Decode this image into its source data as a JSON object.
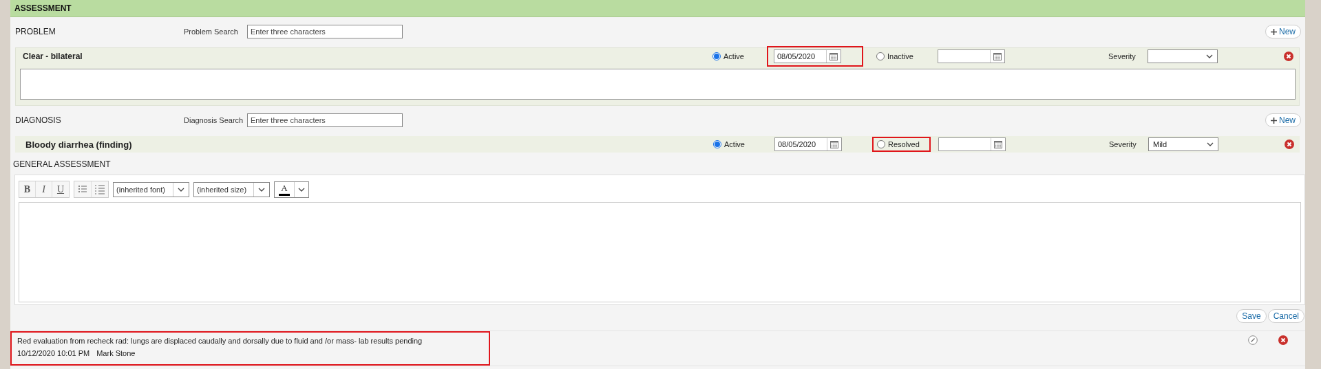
{
  "section_title": "ASSESSMENT",
  "sections": [
    {
      "kind": "problem",
      "label": "PROBLEM",
      "search_label": "Problem Search",
      "search_placeholder": "Enter three characters",
      "new_button": "New",
      "item": {
        "name": "Clear - bilateral",
        "comment_box": true,
        "severity_label": "Severity",
        "options": [
          {
            "label": "Active",
            "selected": true,
            "date": "08/05/2020",
            "date_highlighted": true,
            "highlighted": false
          },
          {
            "label": "Inactive",
            "selected": false,
            "date_highlighted": false,
            "highlighted": false
          }
        ]
      }
    },
    {
      "kind": "diagnosis",
      "label": "DIAGNOSIS",
      "search_label": "Diagnosis Search",
      "search_placeholder": "Enter three characters",
      "new_button": "New",
      "item": {
        "name": "Bloody diarrhea (finding)",
        "comment_box": false,
        "severity_label": "Severity",
        "severity": "Mild",
        "options": [
          {
            "label": "Active",
            "selected": true,
            "date": "08/05/2020",
            "date_highlighted": false,
            "highlighted": false
          },
          {
            "label": "Resolved",
            "selected": false,
            "date_highlighted": false,
            "highlighted": true
          }
        ]
      }
    }
  ],
  "general": {
    "label": "GENERAL ASSESSMENT",
    "toolbar": {
      "bold": "B",
      "italic": "I",
      "underline": "U",
      "font": "(inherited font)",
      "size": "(inherited size)",
      "text_color": "A"
    },
    "buttons": [
      "Save",
      "Cancel"
    ]
  },
  "notes": [
    {
      "text": "Red evaluation from recheck rad: lungs are displaced  caudally and dorsally due to fluid and /or mass- lab results pending",
      "timestamp": "10/12/2020 10:01 PM",
      "author": "Mark Stone",
      "highlighted": true
    }
  ]
}
